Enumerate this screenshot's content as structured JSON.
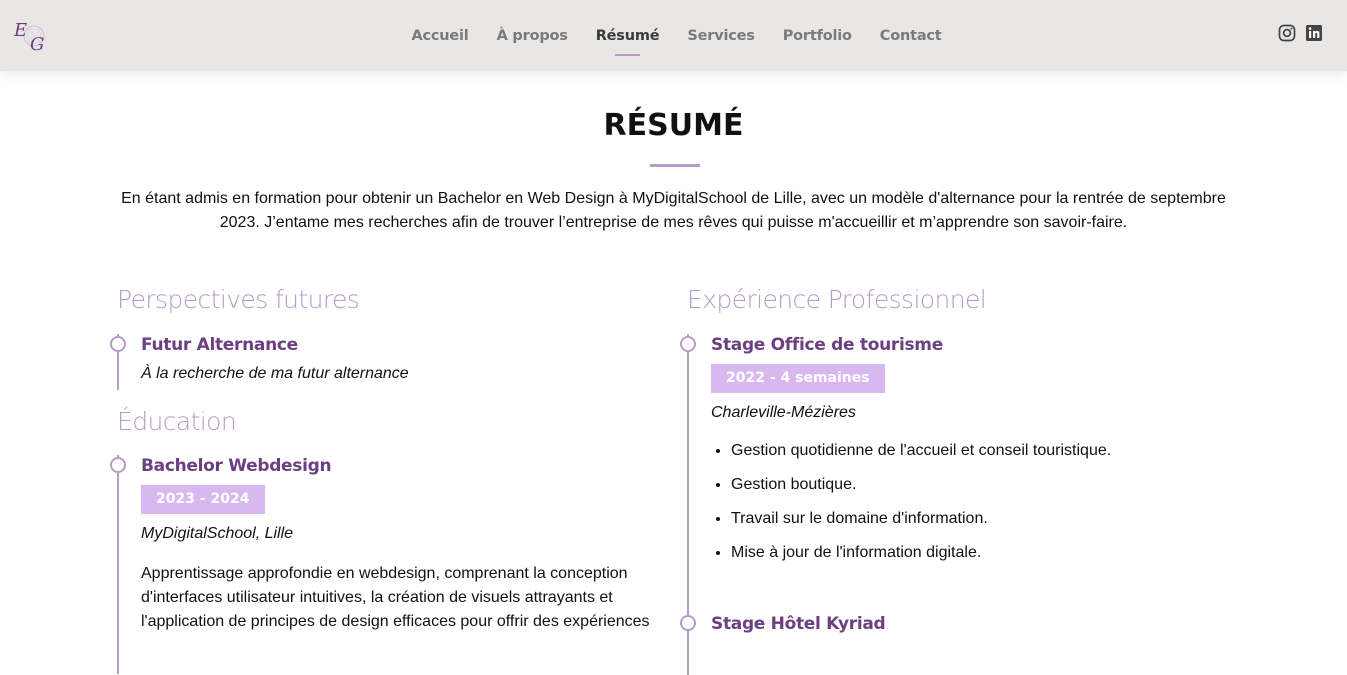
{
  "header": {
    "logo_letters": "EG",
    "nav": [
      {
        "label": "Accueil",
        "active": false
      },
      {
        "label": "À propos",
        "active": false
      },
      {
        "label": "Résumé",
        "active": true
      },
      {
        "label": "Services",
        "active": false
      },
      {
        "label": "Portfolio",
        "active": false
      },
      {
        "label": "Contact",
        "active": false
      }
    ],
    "social": [
      "instagram-icon",
      "linkedin-icon"
    ]
  },
  "section": {
    "title": "RÉSUMÉ",
    "intro": "En étant admis en formation pour obtenir un Bachelor en Web Design à MyDigitalSchool de Lille, avec un modèle d'alternance pour la rentrée de septembre 2023. J’entame mes recherches afin de trouver l’entreprise de mes rêves qui puisse m'accueillir et m’apprendre son savoir-faire."
  },
  "left": {
    "perspectives": {
      "heading": "Perspectives futures",
      "items": [
        {
          "title": "Futur Alternance",
          "place": "À la recherche de ma futur alternance"
        }
      ]
    },
    "education": {
      "heading": "Éducation",
      "items": [
        {
          "title": "Bachelor Webdesign",
          "date": "2023 - 2024",
          "place": "MyDigitalSchool, Lille",
          "description": "Apprentissage approfondie en webdesign, comprenant la conception d'interfaces utilisateur intuitives, la création de visuels attrayants et l'application de principes de design efficaces pour offrir des expériences"
        }
      ]
    }
  },
  "right": {
    "experience": {
      "heading": "Expérience Professionnel",
      "items": [
        {
          "title": "Stage Office de tourisme",
          "date": "2022 - 4 semaines",
          "place": "Charleville-Mézières",
          "bullets": [
            "Gestion quotidienne de l'accueil et conseil touristique.",
            "Gestion boutique.",
            "Travail sur le domaine d'information.",
            "Mise à jour de l'information digitale."
          ]
        },
        {
          "title": "Stage Hôtel Kyriad"
        }
      ]
    }
  },
  "colors": {
    "accent": "#b69bc6",
    "title_purple": "#6c3f80",
    "date_badge": "#d8b9ef",
    "header_bg": "#e8e7e6"
  }
}
